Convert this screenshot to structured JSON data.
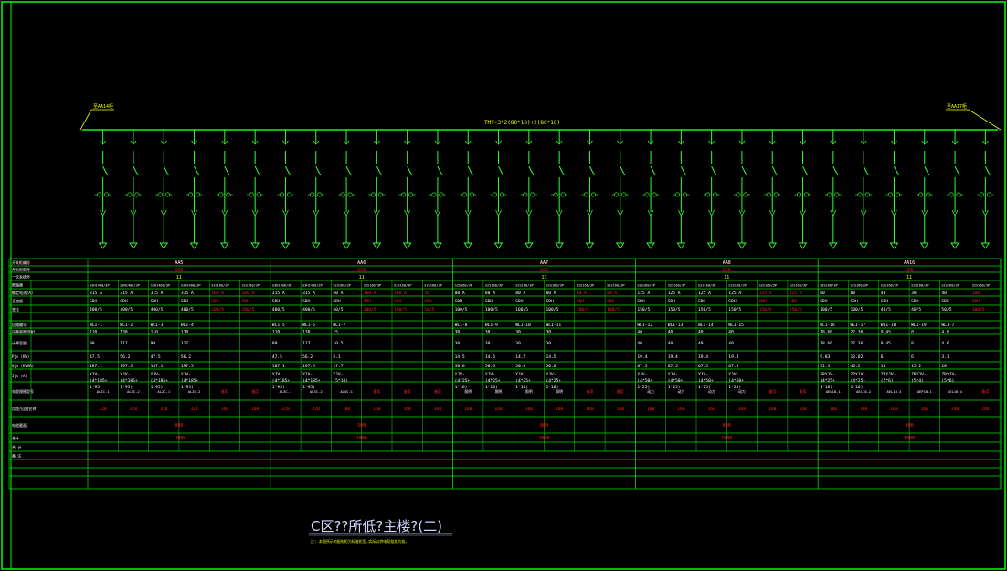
{
  "colors": {
    "background": "#000000",
    "frame": "#00ff00",
    "bus": "#00ff00",
    "wire": "#33ff33",
    "text": "#ffffff",
    "red": "#ff2020",
    "yellow": "#f2ff00",
    "title": "#cfd6ff",
    "grid": "#00e000"
  },
  "drawing": {
    "title": "C区??所低?主楼?(二)",
    "note": "注: 本图所示的配电柜为标准柜型,实际以供电局批准为准。",
    "bus_label": "TMY-3*2(80*10)+2(80*10)",
    "left_tag": "至AA14柜",
    "right_tag": "至AA17柜"
  },
  "row_labels": [
    "开关柜编号",
    "开关柜型号",
    "一次系统号",
    "断路器",
    "额定电流(A)",
    "互感器",
    "变比",
    "回路编号",
    "设备容量(KW)",
    "计算容量",
    "Pjs (KW)",
    "Qjs (KVAR)",
    "Ijs (A)",
    "电缆规格型号",
    "用途/回路名称",
    "电缆截面",
    "合计",
    "合 计",
    "备 注"
  ],
  "panels": [
    {
      "id": "AA5",
      "type": "GCS",
      "sys": "11",
      "circuits": [
        {
          "breaker": "S3H1400/3P",
          "rating": "315 A",
          "ct": "SDH",
          "ratio": "400/5",
          "no": "WL1-1",
          "kw": "110",
          "pjs": "90",
          "qjs": "47.5",
          "ijs": "187.1",
          "cable": "YJV-\n(4*185+\n1*95)",
          "use": "AL1C-1",
          "len": "320"
        },
        {
          "breaker": "S3H1400/3P",
          "rating": "315 A",
          "ct": "SDH",
          "ratio": "400/5",
          "no": "WL1-2",
          "kw": "130",
          "pjs": "117",
          "qjs": "56.2",
          "ijs": "197.5",
          "cable": "YJV-\n(4*185+\n1*95)",
          "use": "AL1C-2",
          "len": "320"
        },
        {
          "breaker": "S3H1400/3P",
          "rating": "315 A",
          "ct": "SDH",
          "ratio": "400/5",
          "no": "WL1-3",
          "kw": "110",
          "pjs": "99",
          "qjs": "47.5",
          "ijs": "187.1",
          "cable": "YJV-\n(4*185+\n1*95)",
          "use": "AL2C-1",
          "len": "320"
        },
        {
          "breaker": "S3H1400/3P",
          "rating": "315 A",
          "ct": "SDH",
          "ratio": "400/5",
          "no": "WL1-4",
          "kw": "130",
          "pjs": "117",
          "qjs": "56.2",
          "ijs": "197.5",
          "cable": "YJV-\n(4*185+\n1*95)",
          "use": "AL2C-2",
          "len": "320"
        },
        {
          "breaker": "S2S160/3P",
          "rating": "160 A",
          "ct": "SDH",
          "ratio": "200/5",
          "no": "",
          "kw": "",
          "pjs": "",
          "qjs": "",
          "ijs": "",
          "cable": "",
          "use": "备用",
          "len": "160",
          "spare": true
        },
        {
          "breaker": "S2S160/3P",
          "rating": "160 A",
          "ct": "SDH",
          "ratio": "200/5",
          "no": "",
          "kw": "",
          "pjs": "",
          "qjs": "",
          "ijs": "",
          "cable": "",
          "use": "备用",
          "len": "160",
          "spare": true
        }
      ],
      "total": "800",
      "sum": "1000"
    },
    {
      "id": "AA6",
      "type": "GCS",
      "sys": "11",
      "circuits": [
        {
          "breaker": "S3H1400/3P",
          "rating": "315 A",
          "ct": "SDH",
          "ratio": "400/5",
          "no": "WL1-5",
          "kw": "110",
          "pjs": "99",
          "qjs": "47.5",
          "ijs": "187.1",
          "cable": "YJV-\n(4*185+\n1*95)",
          "use": "AL3C-1",
          "len": "320"
        },
        {
          "breaker": "S3H1400/3P",
          "rating": "315 A",
          "ct": "SDH",
          "ratio": "400/5",
          "no": "WL1-6",
          "kw": "130",
          "pjs": "117",
          "qjs": "56.2",
          "ijs": "197.5",
          "cable": "YJV-\n(4*185+\n1*95)",
          "use": "AL3C-2",
          "len": "320"
        },
        {
          "breaker": "S2S160/3P",
          "rating": "50 A",
          "ct": "SDH",
          "ratio": "50/5",
          "no": "WL1-7",
          "kw": "15",
          "pjs": "10.5",
          "qjs": "5.1",
          "ijs": "17.7",
          "cable": "YJV-\n(5*10)",
          "use": "AL4C-1",
          "len": "180"
        },
        {
          "breaker": "S2S160/3P",
          "rating": "160 A",
          "ct": "SDH",
          "ratio": "200/5",
          "no": "",
          "kw": "",
          "pjs": "",
          "qjs": "",
          "ijs": "",
          "cable": "",
          "use": "备用",
          "len": "160",
          "spare": true
        },
        {
          "breaker": "S2S160/3P",
          "rating": "100 A",
          "ct": "SDH",
          "ratio": "150/5",
          "no": "",
          "kw": "",
          "pjs": "",
          "qjs": "",
          "ijs": "",
          "cable": "",
          "use": "备用",
          "len": "160",
          "spare": true
        },
        {
          "breaker": "S2S160/3P",
          "rating": "50",
          "ct": "SDH",
          "ratio": "50/5",
          "no": "",
          "kw": "",
          "pjs": "",
          "qjs": "",
          "ijs": "",
          "cable": "",
          "use": "备用",
          "len": "160",
          "spare": true
        }
      ],
      "total": "500",
      "sum": "1000"
    },
    {
      "id": "AA7",
      "type": "GCS",
      "sys": "11",
      "circuits": [
        {
          "breaker": "S2S160/3P",
          "rating": "80 A",
          "ct": "SDH",
          "ratio": "100/5",
          "no": "WL1-8",
          "kw": "30",
          "pjs": "30",
          "qjs": "14.5",
          "ijs": "50.6",
          "cable": "YJV-\n(4*25+\n1*16)",
          "use": "照明",
          "len": "160"
        },
        {
          "breaker": "S2S160/3P",
          "rating": "80 A",
          "ct": "SDH",
          "ratio": "100/5",
          "no": "WL1-9",
          "kw": "30",
          "pjs": "30",
          "qjs": "14.5",
          "ijs": "50.6",
          "cable": "YJV-\n(4*25+\n1*16)",
          "use": "照明",
          "len": "160"
        },
        {
          "breaker": "S2S160/3P",
          "rating": "80 A",
          "ct": "SDH",
          "ratio": "100/5",
          "no": "WL1-10",
          "kw": "30",
          "pjs": "30",
          "qjs": "14.5",
          "ijs": "50.6",
          "cable": "YJV-\n(4*25+\n1*16)",
          "use": "照明",
          "len": "160"
        },
        {
          "breaker": "S2S160/3P",
          "rating": "80 A",
          "ct": "SDH",
          "ratio": "100/5",
          "no": "WL1-11",
          "kw": "30",
          "pjs": "30",
          "qjs": "14.5",
          "ijs": "50.6",
          "cable": "YJV-\n(4*25+\n1*16)",
          "use": "照明",
          "len": "160"
        },
        {
          "breaker": "S2S160/3P",
          "rating": "80 A",
          "ct": "SDH",
          "ratio": "100/5",
          "no": "",
          "kw": "",
          "pjs": "",
          "qjs": "",
          "ijs": "",
          "cable": "",
          "use": "备用",
          "len": "160",
          "spare": true
        },
        {
          "breaker": "S2S160/3P",
          "rating": "80 A",
          "ct": "SDH",
          "ratio": "100/5",
          "no": "",
          "kw": "",
          "pjs": "",
          "qjs": "",
          "ijs": "",
          "cable": "",
          "use": "备用",
          "len": "160",
          "spare": true
        }
      ],
      "total": "800",
      "sum": "1000"
    },
    {
      "id": "AA8",
      "type": "GCS",
      "sys": "11",
      "circuits": [
        {
          "breaker": "S2S160/3P",
          "rating": "125 A",
          "ct": "SDH",
          "ratio": "150/5",
          "no": "WL1-12",
          "kw": "40",
          "pjs": "40",
          "qjs": "19.4",
          "ijs": "67.5",
          "cable": "YJV-\n(4*50+\n1*25)",
          "use": "动力",
          "len": "160"
        },
        {
          "breaker": "S2S160/3P",
          "rating": "125 A",
          "ct": "SDH",
          "ratio": "150/5",
          "no": "WL1-13",
          "kw": "40",
          "pjs": "40",
          "qjs": "19.4",
          "ijs": "67.5",
          "cable": "YJV-\n(4*50+\n1*25)",
          "use": "动力",
          "len": "160"
        },
        {
          "breaker": "S2S160/3P",
          "rating": "125 A",
          "ct": "SDH",
          "ratio": "150/5",
          "no": "WL1-14",
          "kw": "40",
          "pjs": "40",
          "qjs": "19.4",
          "ijs": "67.5",
          "cable": "YJV-\n(4*50+\n1*25)",
          "use": "动力",
          "len": "160"
        },
        {
          "breaker": "S2S160/3P",
          "rating": "125 A",
          "ct": "SDH",
          "ratio": "150/5",
          "no": "WL1-15",
          "kw": "40",
          "pjs": "40",
          "qjs": "19.4",
          "ijs": "67.5",
          "cable": "YJV-\n(4*50+\n1*25)",
          "use": "动力",
          "len": "160"
        },
        {
          "breaker": "S2S160/3P",
          "rating": "125 A",
          "ct": "SDH",
          "ratio": "150/5",
          "no": "",
          "kw": "",
          "pjs": "",
          "qjs": "",
          "ijs": "",
          "cable": "",
          "use": "备用",
          "len": "160",
          "spare": true
        },
        {
          "breaker": "S2S160/3P",
          "rating": "125 A",
          "ct": "SDH",
          "ratio": "150/5",
          "no": "",
          "kw": "",
          "pjs": "",
          "qjs": "",
          "ijs": "",
          "cable": "",
          "use": "备用",
          "len": "160",
          "spare": true
        }
      ],
      "total": "800",
      "sum": "1000"
    },
    {
      "id": "AA16",
      "type": "GCS",
      "sys": "11",
      "circuits": [
        {
          "breaker": "S2S160/3P",
          "rating": "80",
          "ct": "SDH",
          "ratio": "100/5",
          "no": "WL1-16",
          "kw": "18.66",
          "pjs": "18.66",
          "qjs": "9.03",
          "ijs": "31.5",
          "cable": "ZRYJV-\n(4*25+\n1*16)",
          "use": "AEL10-1",
          "len": "160"
        },
        {
          "breaker": "S2S160/3P",
          "rating": "80",
          "ct": "SDH",
          "ratio": "100/5",
          "no": "WL1-17",
          "kw": "27.36",
          "pjs": "27.36",
          "qjs": "13.02",
          "ijs": "46.2",
          "cable": "ZRYJV-\n(4*25+\n1*16)",
          "use": "AEL10-2",
          "len": "160"
        },
        {
          "breaker": "S2S160/3P",
          "rating": "40",
          "ct": "SDH",
          "ratio": "40/5",
          "no": "WL1-18",
          "kw": "9.45",
          "pjs": "9.45",
          "qjs": "6",
          "ijs": "16",
          "cable": "ZRYJV-\n(5*6)",
          "use": "AEL10-3",
          "len": "160"
        },
        {
          "breaker": "S2S160/3P",
          "rating": "30",
          "ct": "SDH",
          "ratio": "40/5",
          "no": "WL1-19",
          "kw": "8",
          "pjs": "8",
          "qjs": "6",
          "ijs": "15.2",
          "cable": "ZRYJV-\n(5*4)",
          "use": "AEP10-1",
          "len": "160"
        },
        {
          "breaker": "S2S160/3P",
          "rating": "40",
          "ct": "SDH",
          "ratio": "50/5",
          "no": "WL1-7",
          "kw": "4.6",
          "pjs": "4.6",
          "qjs": "3.1",
          "ijs": "18",
          "cable": "ZRYJV-\n(5*6)",
          "use": "AEL10-4",
          "len": "240"
        },
        {
          "breaker": "S2S160/3P",
          "rating": "100",
          "ct": "SDH",
          "ratio": "100/5",
          "no": "",
          "kw": "",
          "pjs": "",
          "qjs": "",
          "ijs": "",
          "cable": "",
          "use": "备用",
          "len": "240",
          "spare": true
        }
      ],
      "total": "800",
      "sum": "1000"
    }
  ]
}
